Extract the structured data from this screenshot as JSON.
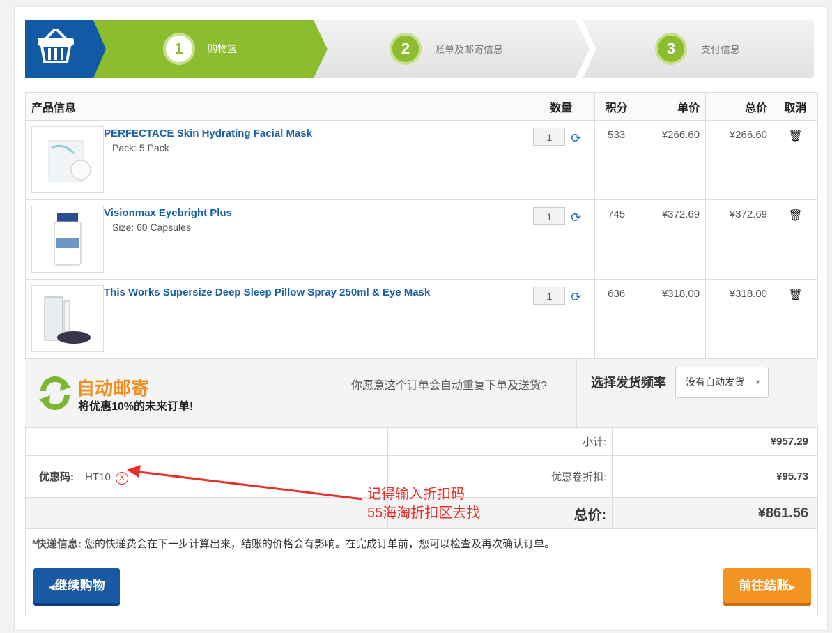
{
  "steps": [
    {
      "num": "1",
      "label": "购物篮"
    },
    {
      "num": "2",
      "label": "账单及邮寄信息"
    },
    {
      "num": "3",
      "label": "支付信息"
    }
  ],
  "colors": {
    "green": "#8cbd2f",
    "blue": "#135aa6",
    "orange": "#f28c1e"
  },
  "table": {
    "headers": {
      "product": "产品信息",
      "qty": "数量",
      "points": "积分",
      "unit": "单价",
      "total": "总价",
      "cancel": "取消"
    },
    "items": [
      {
        "name": "PERFECTACE Skin Hydrating Facial Mask",
        "sub": "Pack: 5 Pack",
        "qty": "1",
        "points": "533",
        "unit": "¥266.60",
        "total": "¥266.60"
      },
      {
        "name": "Visionmax Eyebright Plus",
        "sub": "Size: 60 Capsules",
        "qty": "1",
        "points": "745",
        "unit": "¥372.69",
        "total": "¥372.69"
      },
      {
        "name": "This Works Supersize Deep Sleep Pillow Spray 250ml & Eye Mask",
        "sub": "",
        "qty": "1",
        "points": "636",
        "unit": "¥318.00",
        "total": "¥318.00"
      }
    ]
  },
  "auto": {
    "title": "自动邮寄",
    "subtitle": "将优惠10%的未来订单!",
    "question": "你愿意这个订单会自动重复下单及送货?",
    "freq_label": "选择发货频率",
    "freq_value": "没有自动发货"
  },
  "summary": {
    "coupon_label": "优惠码:",
    "coupon_code": "HT10",
    "coupon_remove": "X",
    "subtotal_label": "小计:",
    "subtotal": "¥957.29",
    "discount_label": "优惠卷折扣:",
    "discount": "¥95.73",
    "total_label": "总价:",
    "total": "¥861.56"
  },
  "note": {
    "label": "*快递信息:",
    "text": " 您的快递费会在下一步计算出来，结账的价格会有影响。在完成订单前，您可以检查及再次确认订单。"
  },
  "buttons": {
    "continue": "继续购物",
    "checkout": "前往结账"
  },
  "annotation": {
    "line1": "记得输入折扣码",
    "line2": "55海淘折扣区去找"
  }
}
